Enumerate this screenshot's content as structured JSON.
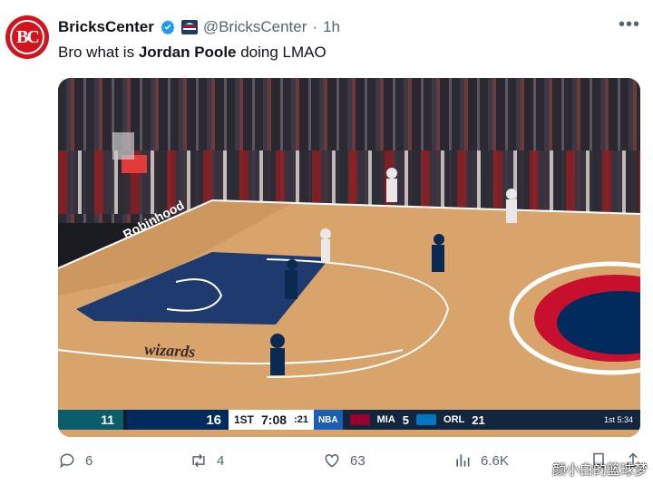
{
  "tweet": {
    "avatar_text": "BC",
    "display_name": "BricksCenter",
    "handle": "@BricksCenter",
    "separator": "·",
    "timestamp": "1h",
    "text_before": "Bro what is ",
    "text_bold": "Jordan Poole",
    "text_after": " doing LMAO"
  },
  "media": {
    "court_wordmark": "wizards",
    "sponsor": "Robinhood",
    "scoreboard": {
      "away_score": "11",
      "home_score": "16",
      "period": "1ST",
      "clock": "7:08",
      "shot_clock": ":21",
      "network": "NBA",
      "other_team1": "MIA",
      "other_score1": "5",
      "other_team2": "ORL",
      "other_score2": "21",
      "other_status": "1st 5:34"
    }
  },
  "actions": {
    "replies": "6",
    "reposts": "4",
    "likes": "63",
    "views": "6.6K"
  },
  "watermark": "颜小白的篮球梦",
  "colors": {
    "avatar_bg": "#d2141c",
    "verified": "#1d9bf0",
    "muted": "#536471"
  }
}
